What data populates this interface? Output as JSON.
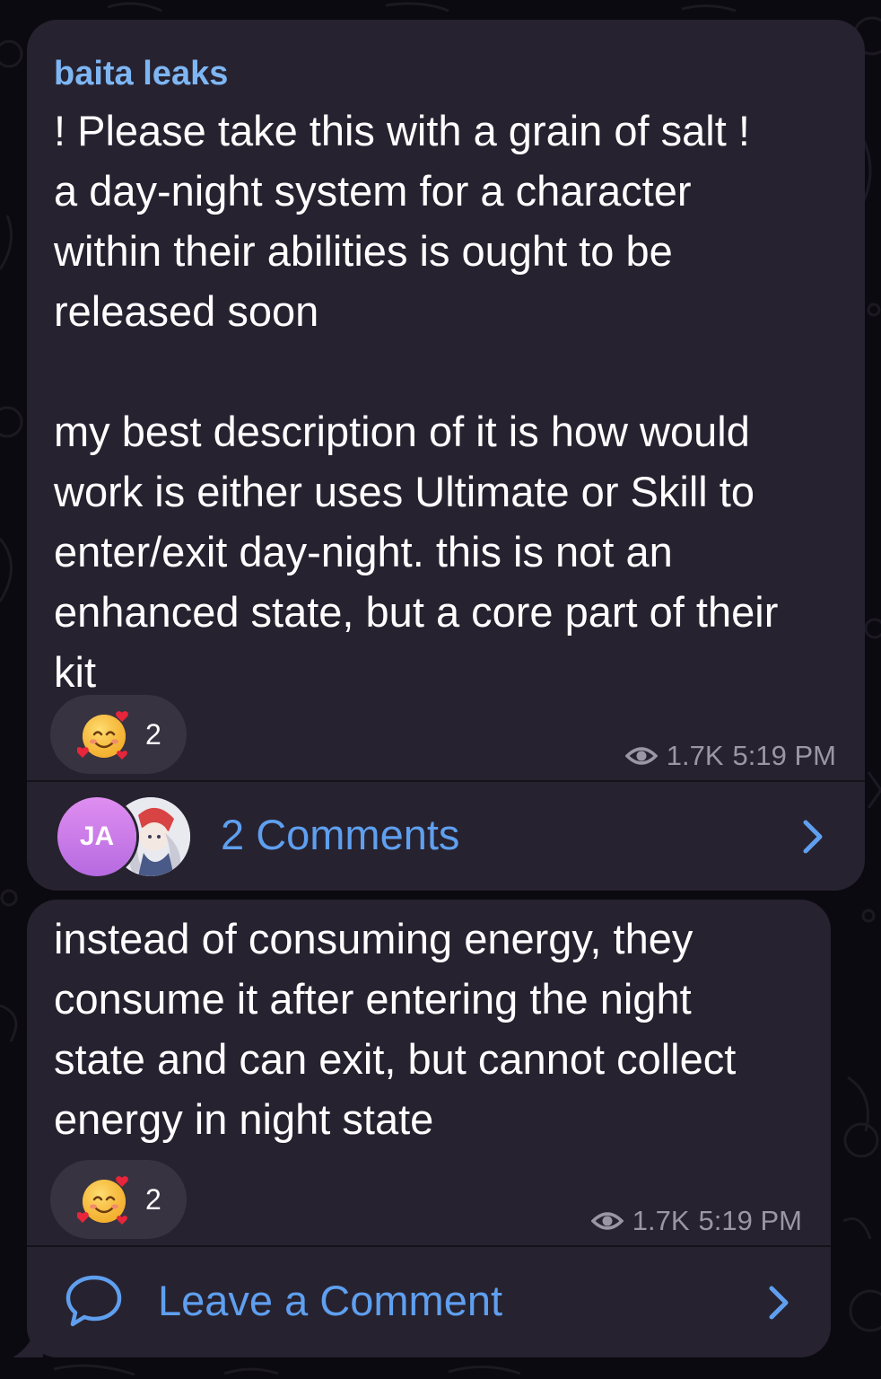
{
  "channel": {
    "name": "baita leaks"
  },
  "posts": [
    {
      "lines": [
        "! Please take this with a grain of salt !",
        "a day-night system for a character",
        "within their abilities is ought to be",
        "released soon",
        "",
        "my best description of it is how would",
        "work is either uses Ultimate or Skill to",
        "enter/exit  day-night. this is not an",
        "enhanced state, but a core part of their",
        "kit"
      ],
      "reaction": {
        "emoji": "smiling-face-with-hearts",
        "count": "2"
      },
      "views": "1.7K",
      "time": "5:19 PM",
      "comments": {
        "avatar_initials": "JA",
        "label": "2 Comments"
      }
    },
    {
      "lines": [
        "instead of consuming energy, they",
        "consume it after entering the night",
        "state and can exit, but cannot collect",
        "energy in night state"
      ],
      "reaction": {
        "emoji": "smiling-face-with-hearts",
        "count": "2"
      },
      "views": "1.7K",
      "time": "5:19 PM",
      "comments": {
        "label": "Leave a Comment"
      }
    }
  ],
  "colors": {
    "background": "#0b0a10",
    "bubble": "#27222f",
    "sender": "#7eb6f4",
    "link": "#5f9fef",
    "meta": "#9b96a5",
    "reaction_pill": "#383341"
  },
  "icons": [
    "eye-icon",
    "chevron-right-icon",
    "speech-bubble-icon",
    "smiling-face-with-hearts-emoji"
  ]
}
